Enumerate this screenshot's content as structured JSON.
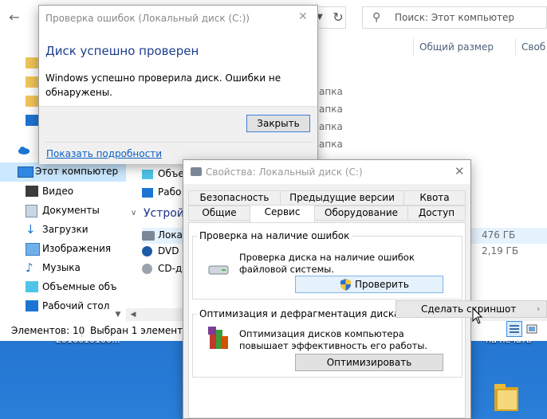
{
  "explorer": {
    "search_placeholder": "Поиск: Этот компьютер",
    "columns": [
      "Общий размер",
      "Своб"
    ],
    "sidebar": [
      {
        "label": "",
        "icon": "folder-icon"
      },
      {
        "label": "",
        "icon": "folder-icon"
      },
      {
        "label": "",
        "icon": "folder-icon"
      },
      {
        "label": "",
        "icon": "folder-icon"
      },
      {
        "label": "",
        "icon": "cloud-icon"
      },
      {
        "label": "Этот компьютер",
        "icon": "computer-icon"
      },
      {
        "label": "Видео",
        "icon": "video-icon"
      },
      {
        "label": "Документы",
        "icon": "documents-icon"
      },
      {
        "label": "Загрузки",
        "icon": "downloads-icon"
      },
      {
        "label": "Изображения",
        "icon": "images-icon"
      },
      {
        "label": "Музыка",
        "icon": "music-icon"
      },
      {
        "label": "Объемные объ",
        "icon": "3d-objects-icon"
      },
      {
        "label": "Рабочий стол",
        "icon": "desktop-icon"
      }
    ],
    "content_fragments": [
      "апка",
      "апка",
      "апка",
      "апка",
      "апка"
    ],
    "behind_items": [
      "Объе",
      "Рабо"
    ],
    "devices_header": "Устрой",
    "devices": [
      {
        "label": "Локал",
        "size": "476 ГБ"
      },
      {
        "label": "DVD R",
        "size": "2,19 ГБ"
      },
      {
        "label": "CD-ди",
        "size": ""
      }
    ],
    "status_count": "Элементов: 10",
    "status_selected": "Выбран 1 элемент"
  },
  "error_dialog": {
    "title": "Проверка ошибок (Локальный диск (C:))",
    "heading": "Диск успешно проверен",
    "message": "Windows успешно проверила диск. Ошибки не обнаружены.",
    "close_button": "Закрыть",
    "details_link": "Показать подробности"
  },
  "properties_dialog": {
    "title": "Свойства: Локальный диск (C:)",
    "tabs_row1": [
      "Безопасность",
      "Предыдущие версии",
      "Квота"
    ],
    "tabs_row2": [
      "Общие",
      "Сервис",
      "Оборудование",
      "Доступ"
    ],
    "active_tab": "Сервис",
    "check_group": {
      "title": "Проверка на наличие ошибок",
      "description": "Проверка диска на наличие ошибок файловой системы.",
      "button": "Проверить"
    },
    "optimize_group": {
      "title": "Оптимизация и дефрагментация диска",
      "description": "Оптимизация дисков компьютера повышает эффективность его работы.",
      "button": "Оптимизировать"
    }
  },
  "context_menu": {
    "item": "Сделать скриншот"
  },
  "desktop": {
    "labels": [
      "2016010100...",
      "на печать"
    ]
  }
}
